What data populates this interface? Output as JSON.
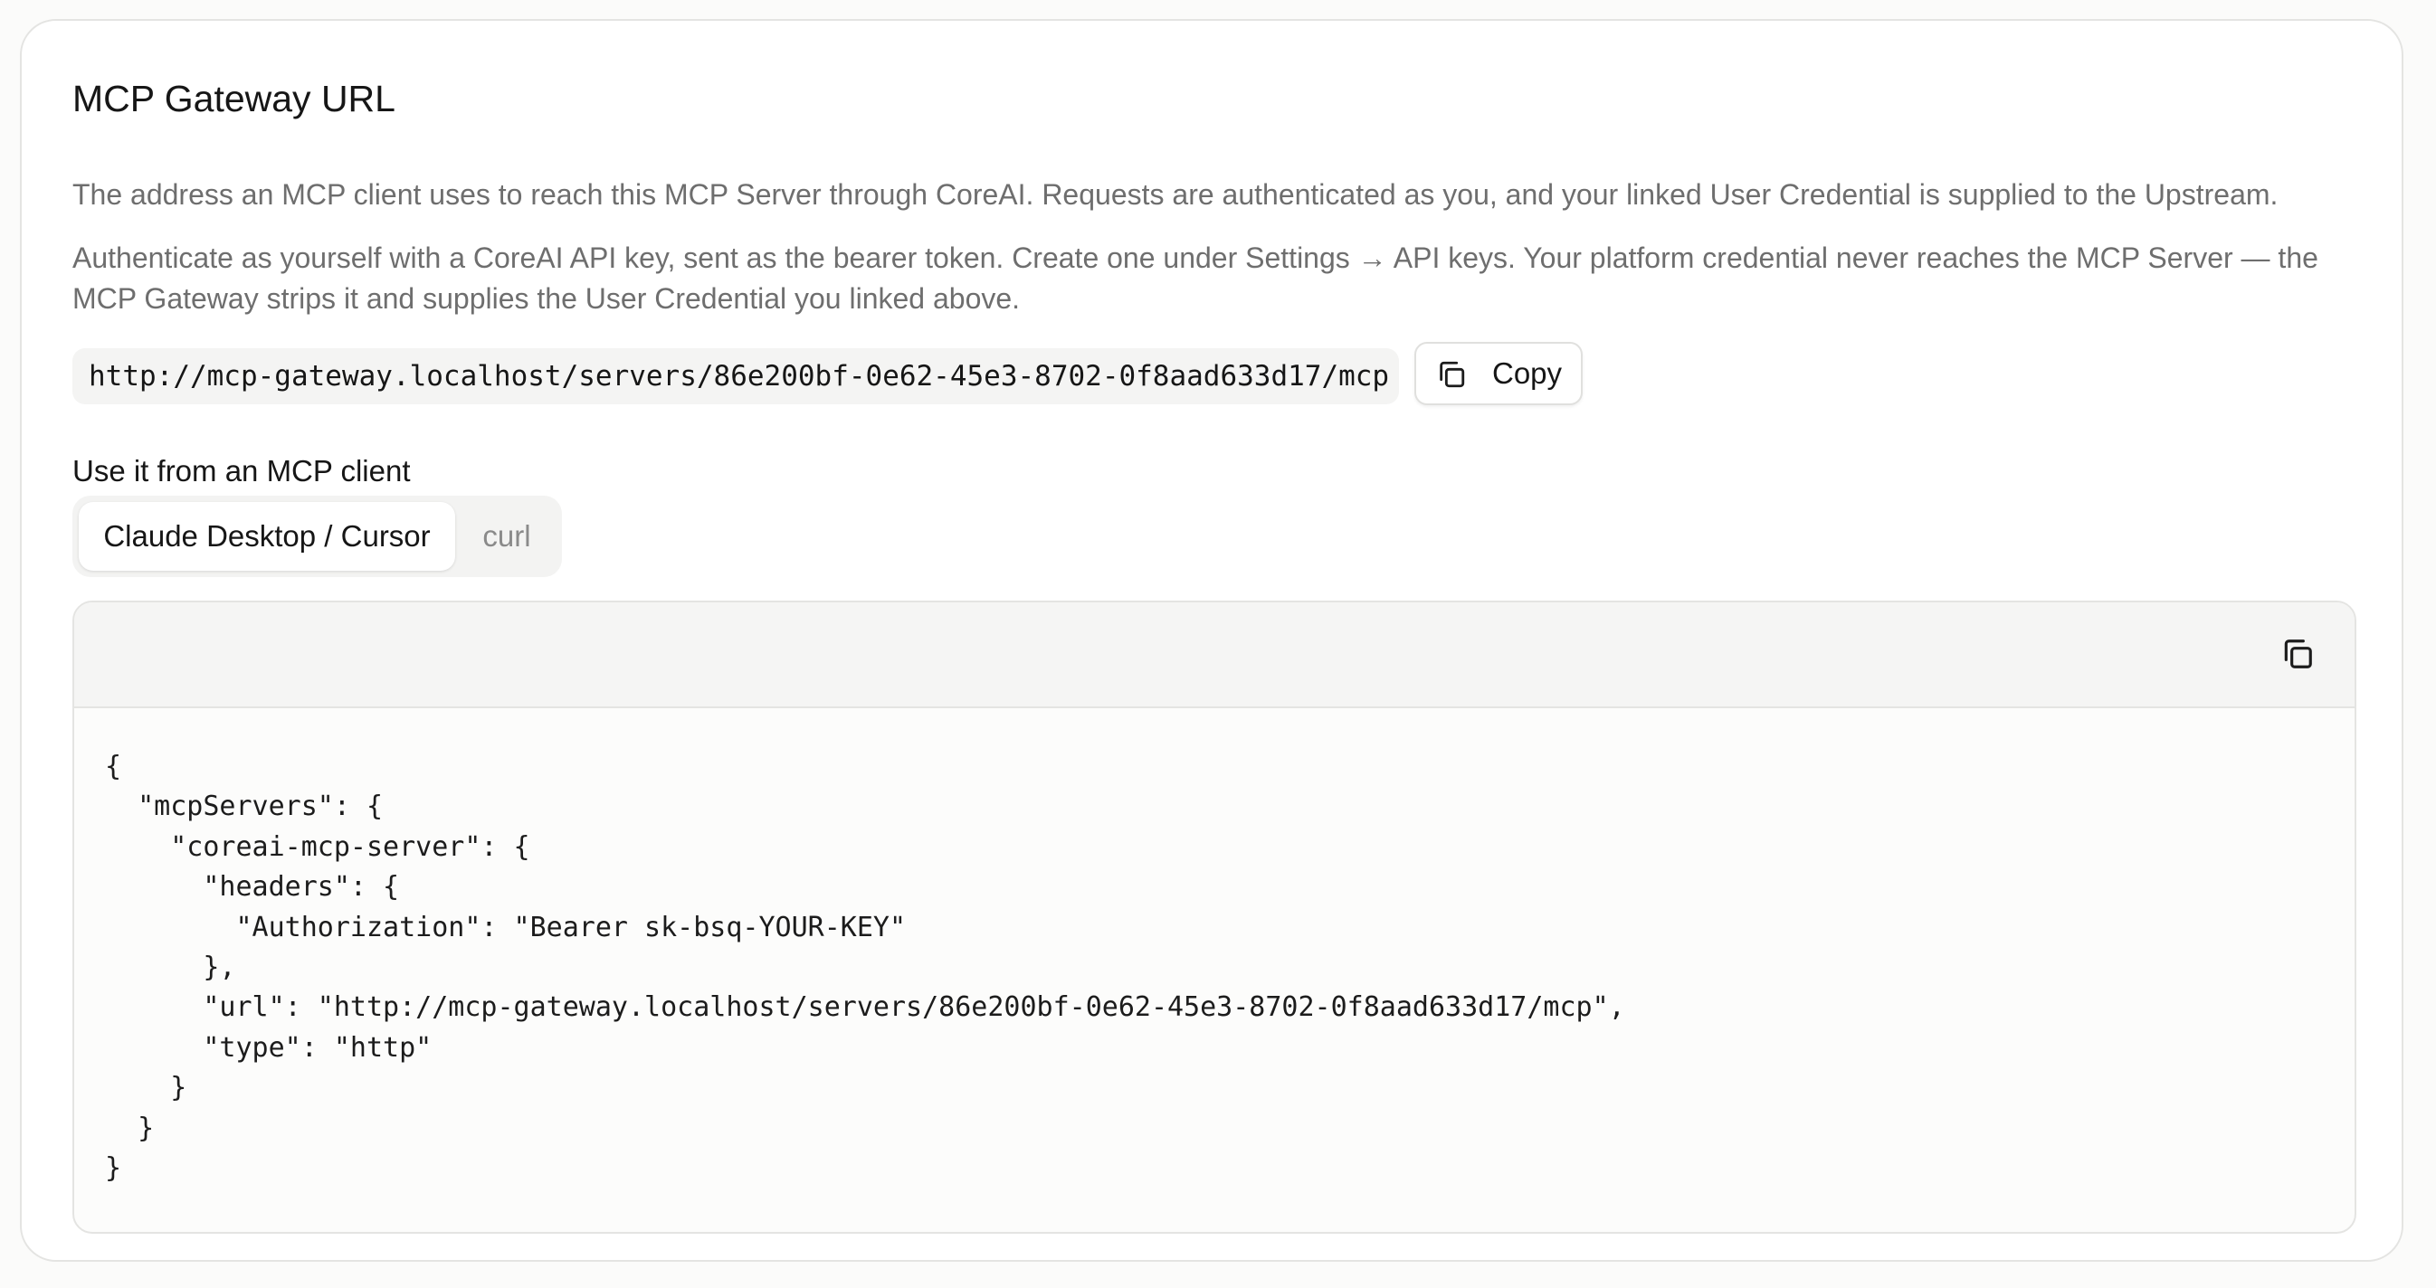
{
  "section": {
    "title": "MCP Gateway URL",
    "description_1": "The address an MCP client uses to reach this MCP Server through CoreAI. Requests are authenticated as you, and your linked User Credential is supplied to the Upstream.",
    "description_2": "Authenticate as yourself with a CoreAI API key, sent as the bearer token. Create one under Settings → API keys. Your platform credential never reaches the MCP Server — the MCP Gateway strips it and supplies the User Credential you linked above."
  },
  "gateway": {
    "url": "http://mcp-gateway.localhost/servers/86e200bf-0e62-45e3-8702-0f8aad633d17/mcp",
    "copy_label": "Copy",
    "copy_icon": "copy-icon"
  },
  "client": {
    "heading": "Use it from an MCP client",
    "tabs": [
      {
        "label": "Claude Desktop / Cursor",
        "active": true
      },
      {
        "label": "curl",
        "active": false
      }
    ],
    "code_copy_icon": "copy-icon",
    "code": "{\n  \"mcpServers\": {\n    \"coreai-mcp-server\": {\n      \"headers\": {\n        \"Authorization\": \"Bearer sk-bsq-YOUR-KEY\"\n      },\n      \"url\": \"http://mcp-gateway.localhost/servers/86e200bf-0e62-45e3-8702-0f8aad633d17/mcp\",\n      \"type\": \"http\"\n    }\n  }\n}"
  },
  "colors": {
    "background": "#fbfbfa",
    "card": "#ffffff",
    "muted_text": "#6e6e6e",
    "border": "#e4e4e2"
  }
}
